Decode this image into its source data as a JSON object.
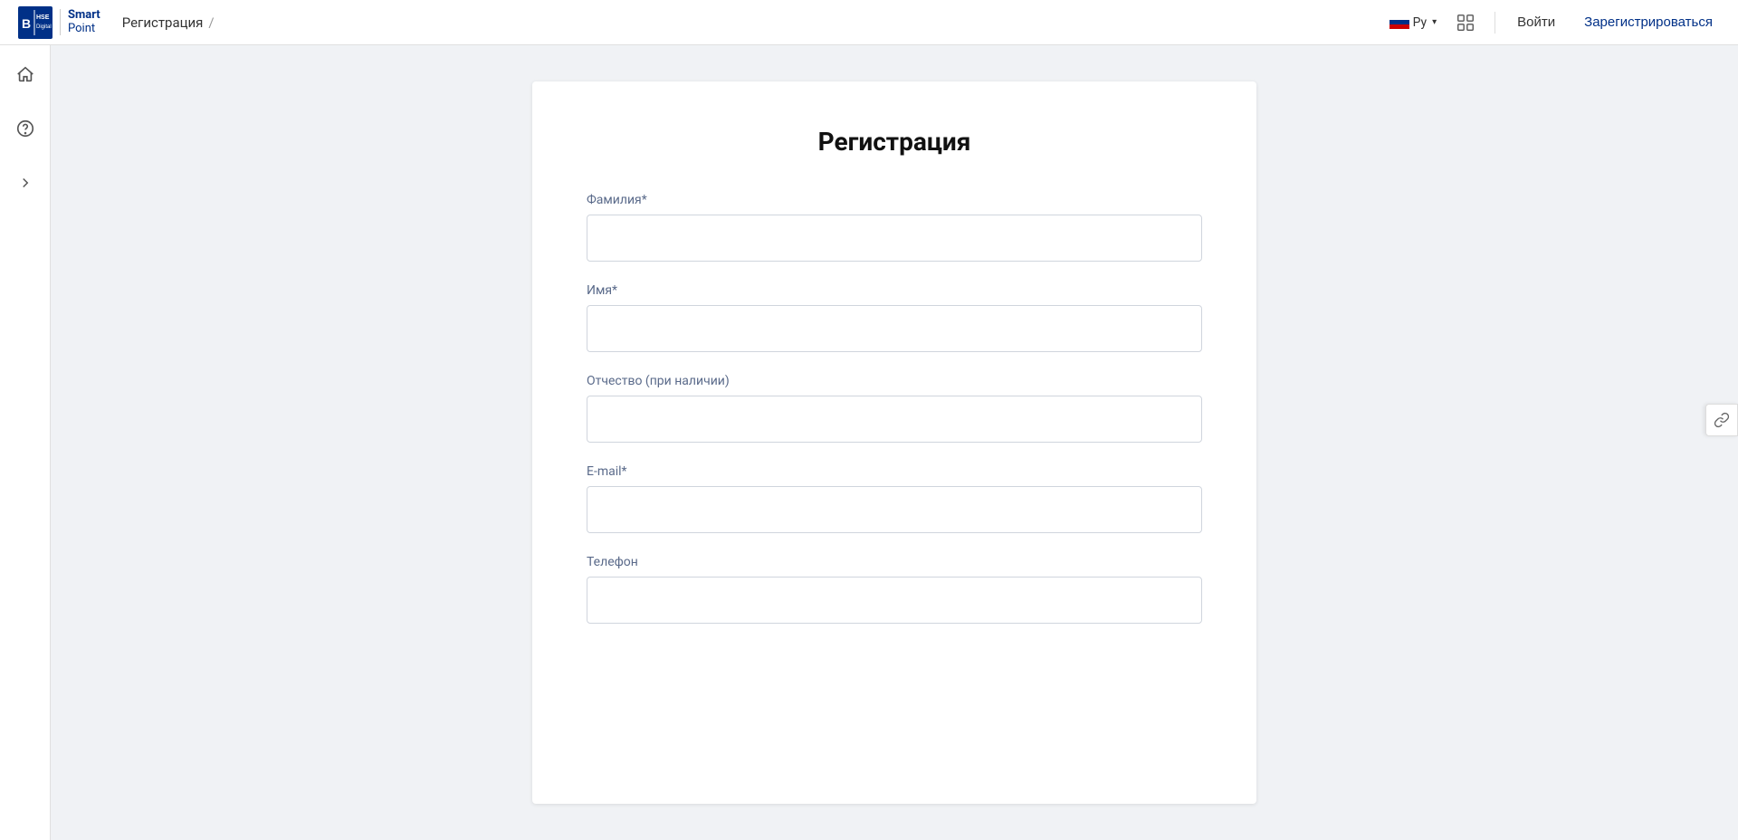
{
  "header": {
    "logo_hse": "Вышка Digital",
    "logo_smart": "Smart",
    "logo_point": "Point",
    "breadcrumb": "Регистрация",
    "breadcrumb_sep": "/",
    "lang": "Ру",
    "login_label": "Войти",
    "register_label": "Зарегистрироваться"
  },
  "sidebar": {
    "home_icon": "⌂",
    "help_icon": "?",
    "expand_icon": "❯"
  },
  "form": {
    "title": "Регистрация",
    "fields": [
      {
        "id": "lastname",
        "label": "Фамилия*",
        "placeholder": "",
        "value": ""
      },
      {
        "id": "firstname",
        "label": "Имя*",
        "placeholder": "",
        "value": ""
      },
      {
        "id": "patronymic",
        "label": "Отчество (при наличии)",
        "placeholder": "",
        "value": ""
      },
      {
        "id": "email",
        "label": "E-mail*",
        "placeholder": "",
        "value": ""
      },
      {
        "id": "phone",
        "label": "Телефон",
        "placeholder": "",
        "value": ""
      }
    ]
  },
  "float_button": {
    "icon": "🔗"
  }
}
